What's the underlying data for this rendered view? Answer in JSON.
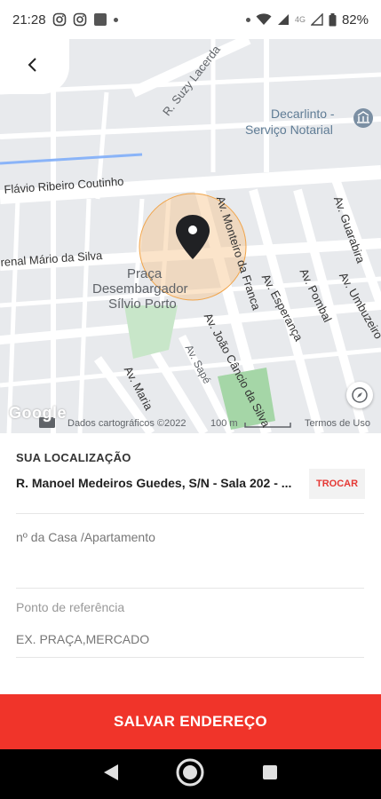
{
  "status_bar": {
    "time": "21:28",
    "network": "4G",
    "battery": "82%"
  },
  "map": {
    "labels": {
      "street_suzy": "R. Suzy Lacerda",
      "decarlinto": "Decarlinto -",
      "servico_notarial": "Serviço Notarial",
      "flavio": "Flávio Ribeiro Coutinho",
      "mario": "renal Mário da Silva",
      "praca_1": "Praça",
      "praca_2": "Desembargador",
      "praca_3": "Sílvio Porto",
      "monteiro": "Av. Monteiro da Franca",
      "esperanca": "Av. Esperança",
      "pombal": "Av. Pombal",
      "guarabira": "Av. Guarabira",
      "umbuzeiro": "Av. Umbuzeiro",
      "joao_cancio": "Av. João Câncio da Silva",
      "sape": "Av. Sapé",
      "maria": "Av. Maria",
      "dados": "Dados cartográficos ©2022",
      "scale": "100 m",
      "termos": "Termos de Uso",
      "google": "Google"
    }
  },
  "form": {
    "section_title": "SUA LOCALIZAÇÃO",
    "address": "R. Manoel Medeiros Guedes, S/N - Sala 202 - ...",
    "change_label": "TROCAR",
    "number_placeholder": "nº da Casa /Apartamento",
    "reference_label": "Ponto de referência",
    "reference_placeholder": "EX. PRAÇA,MERCADO"
  },
  "save_label": "SALVAR ENDEREÇO",
  "colors": {
    "accent": "#f0342a",
    "change_text": "#e53935"
  }
}
